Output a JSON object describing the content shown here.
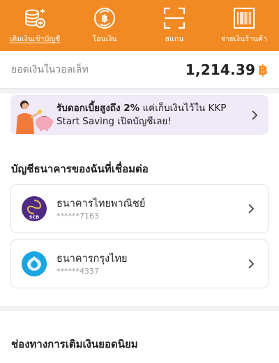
{
  "topbar": {
    "items": [
      {
        "label": "เติมเงินเข้าบัญชี",
        "icon": "coins-add-icon",
        "active": true
      },
      {
        "label": "โอนเงิน",
        "icon": "baht-coin-icon",
        "active": false
      },
      {
        "label": "สแกน",
        "icon": "scan-frame-icon",
        "active": false
      },
      {
        "label": "จ่ายเงินร้านค้า",
        "icon": "barcode-icon",
        "active": false
      }
    ],
    "bg_color": "#f28a24"
  },
  "balance": {
    "label": "ยอดเงินในวอลเล็ท",
    "amount": "1,214.39",
    "currency_symbol": "฿"
  },
  "promo": {
    "text_bold": "รับดอกเบี้ยสูงถึง 2%",
    "text_rest": " แค่เก็บเงินไว้ใน KKP Start Saving เปิดบัญชีเลย!"
  },
  "linked_banks": {
    "title": "บัญชีธนาคารของฉันที่เชื่อมต่อ",
    "items": [
      {
        "name": "ธนาคารไทยพาณิชย์",
        "account": "******7163",
        "logo": "scb-logo",
        "logo_text": "SCB",
        "color": "#4e2a84"
      },
      {
        "name": "ธนาคารกรุงไทย",
        "account": "******4337",
        "logo": "ktb-logo",
        "color": "#1ba5e1"
      }
    ]
  },
  "topup_channels": {
    "title": "ช่องทางการเติมเงินยอดนิยม"
  }
}
